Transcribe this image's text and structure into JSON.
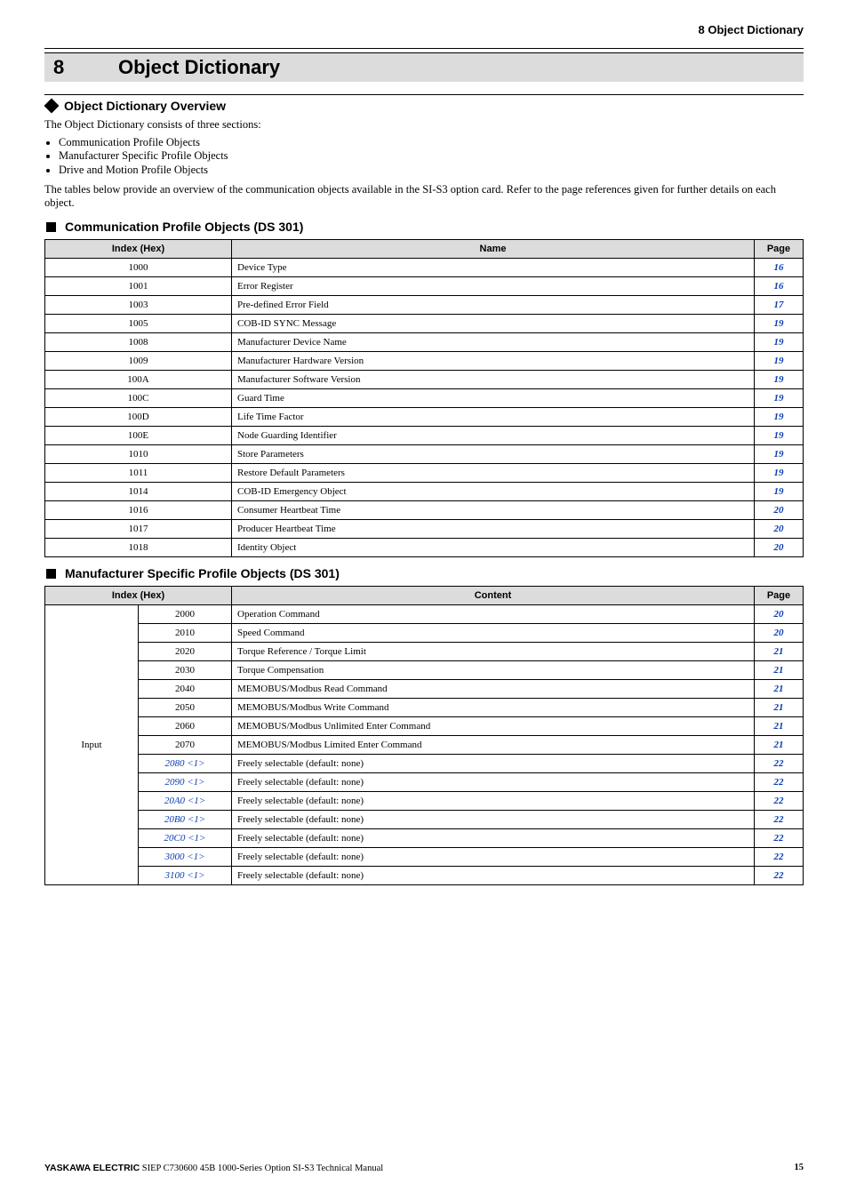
{
  "header": {
    "section_label": "8  Object Dictionary"
  },
  "chapter": {
    "number": "8",
    "title": "Object Dictionary"
  },
  "overview": {
    "heading": "Object Dictionary Overview",
    "intro": "The Object Dictionary consists of three sections:",
    "bullets": [
      "Communication Profile Objects",
      "Manufacturer Specific Profile Objects",
      "Drive and Motion Profile Objects"
    ],
    "after": "The tables below provide an overview of the communication objects available in the SI-S3 option card. Refer to the page references given for further details on each object."
  },
  "comm_table": {
    "heading": "Communication Profile Objects (DS 301)",
    "columns": {
      "col1": "Index (Hex)",
      "col2": "Name",
      "col3": "Page"
    },
    "rows": [
      {
        "idx": "1000",
        "name": "Device Type",
        "page": "16"
      },
      {
        "idx": "1001",
        "name": "Error Register",
        "page": "16"
      },
      {
        "idx": "1003",
        "name": "Pre-defined Error Field",
        "page": "17"
      },
      {
        "idx": "1005",
        "name": "COB-ID SYNC Message",
        "page": "19"
      },
      {
        "idx": "1008",
        "name": "Manufacturer Device Name",
        "page": "19"
      },
      {
        "idx": "1009",
        "name": "Manufacturer Hardware Version",
        "page": "19"
      },
      {
        "idx": "100A",
        "name": "Manufacturer Software Version",
        "page": "19"
      },
      {
        "idx": "100C",
        "name": "Guard Time",
        "page": "19"
      },
      {
        "idx": "100D",
        "name": "Life Time Factor",
        "page": "19"
      },
      {
        "idx": "100E",
        "name": "Node Guarding Identifier",
        "page": "19"
      },
      {
        "idx": "1010",
        "name": "Store Parameters",
        "page": "19"
      },
      {
        "idx": "1011",
        "name": "Restore Default Parameters",
        "page": "19"
      },
      {
        "idx": "1014",
        "name": "COB-ID Emergency Object",
        "page": "19"
      },
      {
        "idx": "1016",
        "name": "Consumer Heartbeat Time",
        "page": "20"
      },
      {
        "idx": "1017",
        "name": "Producer Heartbeat Time",
        "page": "20"
      },
      {
        "idx": "1018",
        "name": "Identity Object",
        "page": "20"
      }
    ]
  },
  "manu_table": {
    "heading": "Manufacturer Specific Profile Objects (DS 301)",
    "columns": {
      "col1": "Index (Hex)",
      "col2": "Content",
      "col3": "Page"
    },
    "group_label": "Input",
    "note_suffix": "<1>",
    "rows": [
      {
        "idx": "2000",
        "link": false,
        "content": "Operation Command",
        "page": "20"
      },
      {
        "idx": "2010",
        "link": false,
        "content": "Speed Command",
        "page": "20"
      },
      {
        "idx": "2020",
        "link": false,
        "content": "Torque Reference / Torque Limit",
        "page": "21"
      },
      {
        "idx": "2030",
        "link": false,
        "content": "Torque Compensation",
        "page": "21"
      },
      {
        "idx": "2040",
        "link": false,
        "content": "MEMOBUS/Modbus Read Command",
        "page": "21"
      },
      {
        "idx": "2050",
        "link": false,
        "content": "MEMOBUS/Modbus Write Command",
        "page": "21"
      },
      {
        "idx": "2060",
        "link": false,
        "content": "MEMOBUS/Modbus Unlimited Enter Command",
        "page": "21"
      },
      {
        "idx": "2070",
        "link": false,
        "content": "MEMOBUS/Modbus Limited Enter Command",
        "page": "21"
      },
      {
        "idx": "2080",
        "link": true,
        "content": "Freely selectable (default: none)",
        "page": "22"
      },
      {
        "idx": "2090",
        "link": true,
        "content": "Freely selectable (default: none)",
        "page": "22"
      },
      {
        "idx": "20A0",
        "link": true,
        "content": "Freely selectable (default: none)",
        "page": "22"
      },
      {
        "idx": "20B0",
        "link": true,
        "content": "Freely selectable (default: none)",
        "page": "22"
      },
      {
        "idx": "20C0",
        "link": true,
        "content": "Freely selectable (default: none)",
        "page": "22"
      },
      {
        "idx": "3000",
        "link": true,
        "content": "Freely selectable (default: none)",
        "page": "22"
      },
      {
        "idx": "3100",
        "link": true,
        "content": "Freely selectable (default: none)",
        "page": "22"
      }
    ]
  },
  "footer": {
    "brand": "YASKAWA ELECTRIC",
    "doc": " SIEP C730600 45B 1000-Series Option SI-S3 Technical Manual",
    "page": "15"
  }
}
